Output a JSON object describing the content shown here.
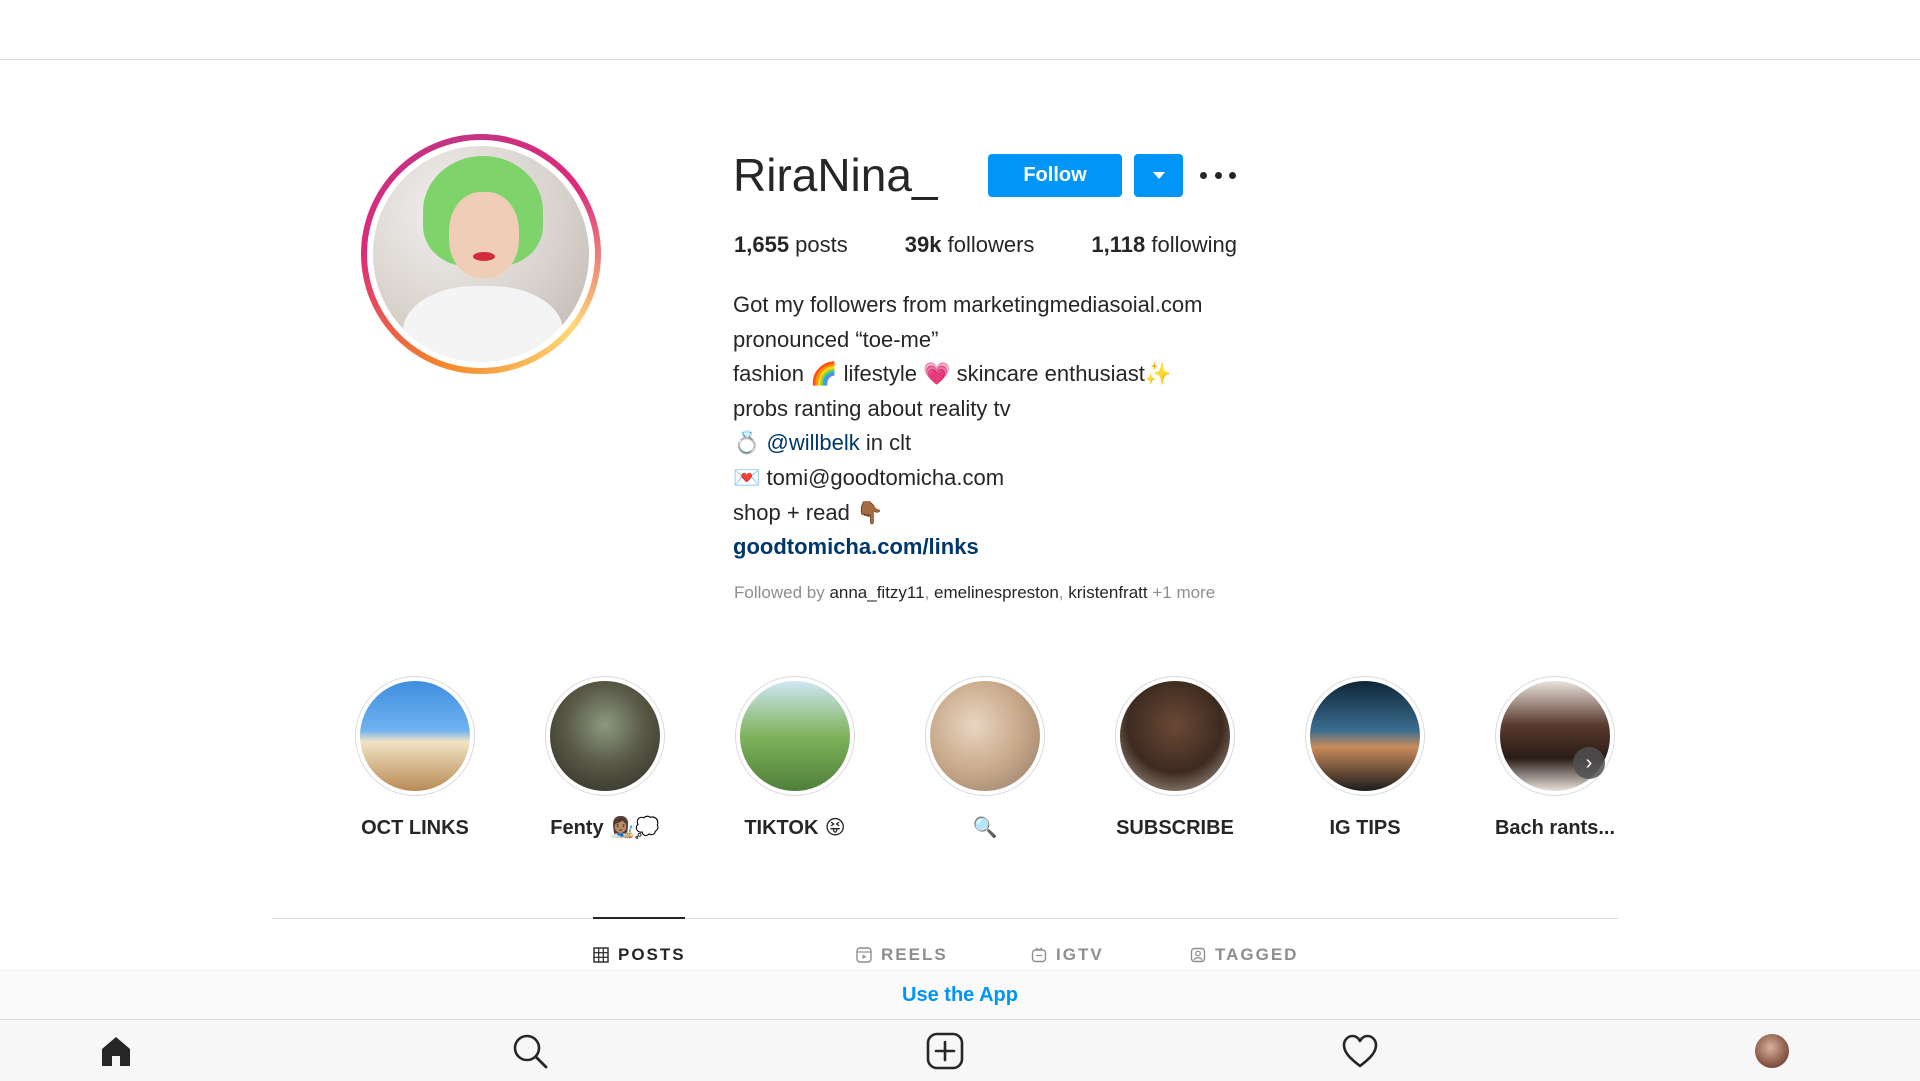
{
  "profile": {
    "username": "RiraNina_",
    "follow_label": "Follow",
    "stats": {
      "posts_count": "1,655",
      "posts_label": " posts",
      "followers_count": "39k",
      "followers_label": " followers",
      "following_count": "1,118",
      "following_label": " following"
    },
    "bio": {
      "line1": "Got my followers from marketingmediasoial.com",
      "line2": "pronounced “toe-me”",
      "line3_a": "fashion ",
      "line3_emoji1": "🌈",
      "line3_b": " lifestyle ",
      "line3_emoji2": "💗",
      "line3_c": " skincare enthusiast",
      "line3_emoji3": "✨",
      "line4": "probs ranting about reality tv",
      "line5_emoji": "💍",
      "line5_mention": "@willbelk",
      "line5_text": " in clt",
      "line6_emoji": "💌",
      "line6_text": " tomi@goodtomicha.com",
      "line7_text": "shop + read ",
      "line7_emoji": "👇🏾",
      "link": "goodtomicha.com/links"
    },
    "followed_by": {
      "prefix": "Followed by ",
      "accounts": [
        "anna_fitzy11",
        "emelinespreston",
        "kristenfratt"
      ],
      "suffix": " +1 more"
    }
  },
  "highlights": [
    {
      "label": "OCT LINKS",
      "emoji": ""
    },
    {
      "label": "Fenty",
      "emoji": " 👩🏽‍🎨💭"
    },
    {
      "label": "TIKTOK",
      "emoji": " 😝"
    },
    {
      "label": "",
      "emoji": "🔍"
    },
    {
      "label": "SUBSCRIBE",
      "emoji": ""
    },
    {
      "label": "IG TIPS",
      "emoji": ""
    },
    {
      "label": "Bach rants...",
      "emoji": ""
    }
  ],
  "highlight_next_glyph": "›",
  "tabs": [
    {
      "label": "POSTS",
      "icon": "grid-icon",
      "active": true
    },
    {
      "label": "REELS",
      "icon": "reels-icon",
      "active": false
    },
    {
      "label": "IGTV",
      "icon": "igtv-icon",
      "active": false
    },
    {
      "label": "TAGGED",
      "icon": "tagged-icon",
      "active": false
    }
  ],
  "use_app_label": "Use the App",
  "bottom_nav": [
    "home-icon",
    "search-icon",
    "new-post-icon",
    "activity-heart-icon",
    "profile-avatar"
  ],
  "colors": {
    "accent": "#0095f6",
    "link": "#00376b",
    "text": "#262626",
    "muted": "#8e8e8e"
  }
}
